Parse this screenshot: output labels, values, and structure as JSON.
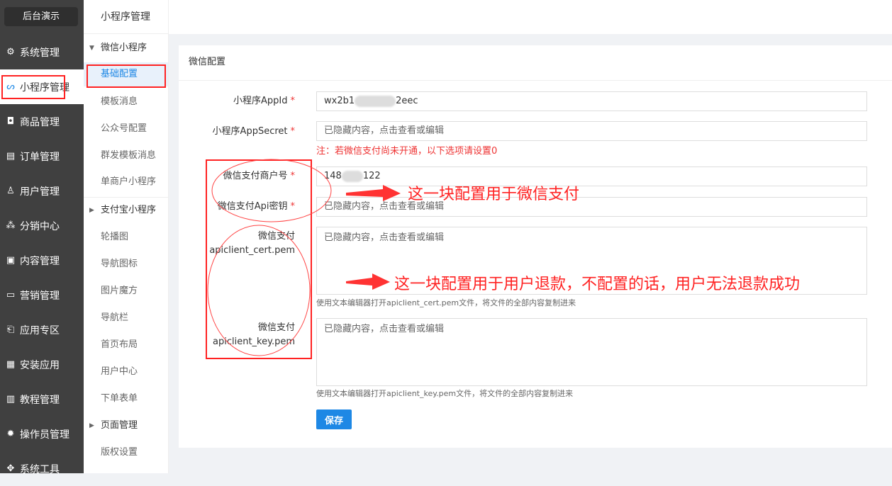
{
  "brand": "后台演示",
  "sidebar": {
    "items": [
      {
        "label": "系统管理",
        "icon": "gear-icon",
        "glyph": "⚙"
      },
      {
        "label": "小程序管理",
        "icon": "mini-program-icon",
        "glyph": "ᔕ"
      },
      {
        "label": "商品管理",
        "icon": "bag-icon",
        "glyph": "◘"
      },
      {
        "label": "订单管理",
        "icon": "order-icon",
        "glyph": "▤"
      },
      {
        "label": "用户管理",
        "icon": "user-icon",
        "glyph": "♙"
      },
      {
        "label": "分销中心",
        "icon": "org-icon",
        "glyph": "⁂"
      },
      {
        "label": "内容管理",
        "icon": "content-icon",
        "glyph": "▣"
      },
      {
        "label": "营销管理",
        "icon": "ticket-icon",
        "glyph": "▭"
      },
      {
        "label": "应用专区",
        "icon": "app-icon",
        "glyph": "⎗"
      },
      {
        "label": "安装应用",
        "icon": "grid-icon",
        "glyph": "▦"
      },
      {
        "label": "教程管理",
        "icon": "book-icon",
        "glyph": "▥"
      },
      {
        "label": "操作员管理",
        "icon": "settings-icon",
        "glyph": "✹"
      },
      {
        "label": "系统工具",
        "icon": "tool-icon",
        "glyph": "✥"
      }
    ]
  },
  "subnav": {
    "title": "小程序管理",
    "items": [
      {
        "label": "微信小程序",
        "group": true,
        "expanded": true
      },
      {
        "label": "基础配置",
        "active": true
      },
      {
        "label": "模板消息"
      },
      {
        "label": "公众号配置"
      },
      {
        "label": "群发模板消息"
      },
      {
        "label": "单商户小程序"
      },
      {
        "label": "支付宝小程序",
        "group": true,
        "expanded": false
      },
      {
        "label": "轮播图"
      },
      {
        "label": "导航图标"
      },
      {
        "label": "图片魔方"
      },
      {
        "label": "导航栏"
      },
      {
        "label": "首页布局"
      },
      {
        "label": "用户中心"
      },
      {
        "label": "下单表单"
      },
      {
        "label": "页面管理",
        "group": true,
        "expanded": false
      },
      {
        "label": "版权设置"
      }
    ]
  },
  "form": {
    "title": "微信配置",
    "appid_label": "小程序AppId",
    "appid_prefix": "wx2b1",
    "appid_suffix": "2eec",
    "secret_label": "小程序AppSecret",
    "secret_value": "已隐藏内容，点击查看或编辑",
    "note": "注：若微信支付尚未开通，以下选项请设置0",
    "mch_label": "微信支付商户号",
    "mch_prefix": "148",
    "mch_suffix": "122",
    "apikey_label": "微信支付Api密钥",
    "apikey_value": "已隐藏内容，点击查看或编辑",
    "cert_label1": "微信支付",
    "cert_label2": "apiclient_cert.pem",
    "cert_value": "已隐藏内容，点击查看或编辑",
    "cert_hint": "使用文本编辑器打开apiclient_cert.pem文件，将文件的全部内容复制进来",
    "key_label1": "微信支付",
    "key_label2": "apiclient_key.pem",
    "key_value": "已隐藏内容，点击查看或编辑",
    "key_hint": "使用文本编辑器打开apiclient_key.pem文件，将文件的全部内容复制进来",
    "required_mark": "*",
    "save": "保存"
  },
  "annotations": {
    "pay": "这一块配置用于微信支付",
    "refund": "这一块配置用于用户退款，不配置的话，用户无法退款成功",
    "color": "#ff2222"
  }
}
